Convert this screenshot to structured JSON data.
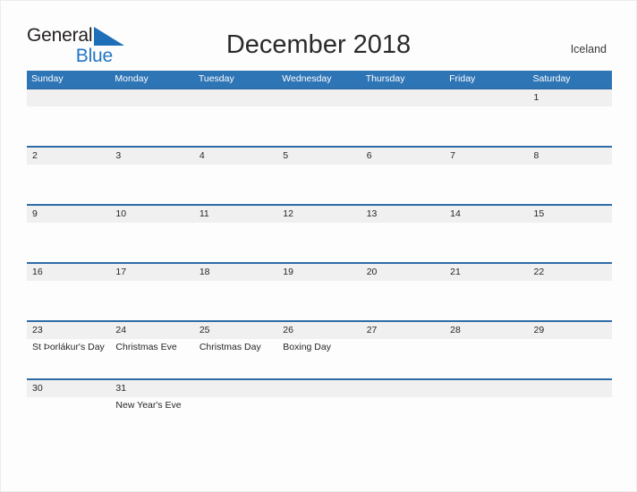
{
  "brand": {
    "word_one": "General",
    "word_two": "Blue",
    "flag_icon": "blue-triangle-flag-icon",
    "dark_color": "#231f20",
    "blue_color": "#2275c4"
  },
  "header": {
    "title": "December 2018",
    "region": "Iceland"
  },
  "colors": {
    "header_blue": "#2e75b6",
    "row_separator_blue": "#2e6ca8",
    "date_band_gray": "#f0f0f0",
    "text_dark": "#262626"
  },
  "calendar": {
    "month": "December",
    "year": "2018",
    "weekday_headers": [
      "Sunday",
      "Monday",
      "Tuesday",
      "Wednesday",
      "Thursday",
      "Friday",
      "Saturday"
    ],
    "weeks": [
      {
        "days": [
          {
            "date": "",
            "event": ""
          },
          {
            "date": "",
            "event": ""
          },
          {
            "date": "",
            "event": ""
          },
          {
            "date": "",
            "event": ""
          },
          {
            "date": "",
            "event": ""
          },
          {
            "date": "",
            "event": ""
          },
          {
            "date": "1",
            "event": ""
          }
        ]
      },
      {
        "days": [
          {
            "date": "2",
            "event": ""
          },
          {
            "date": "3",
            "event": ""
          },
          {
            "date": "4",
            "event": ""
          },
          {
            "date": "5",
            "event": ""
          },
          {
            "date": "6",
            "event": ""
          },
          {
            "date": "7",
            "event": ""
          },
          {
            "date": "8",
            "event": ""
          }
        ]
      },
      {
        "days": [
          {
            "date": "9",
            "event": ""
          },
          {
            "date": "10",
            "event": ""
          },
          {
            "date": "11",
            "event": ""
          },
          {
            "date": "12",
            "event": ""
          },
          {
            "date": "13",
            "event": ""
          },
          {
            "date": "14",
            "event": ""
          },
          {
            "date": "15",
            "event": ""
          }
        ]
      },
      {
        "days": [
          {
            "date": "16",
            "event": ""
          },
          {
            "date": "17",
            "event": ""
          },
          {
            "date": "18",
            "event": ""
          },
          {
            "date": "19",
            "event": ""
          },
          {
            "date": "20",
            "event": ""
          },
          {
            "date": "21",
            "event": ""
          },
          {
            "date": "22",
            "event": ""
          }
        ]
      },
      {
        "days": [
          {
            "date": "23",
            "event": "St Þorlákur's Day"
          },
          {
            "date": "24",
            "event": "Christmas Eve"
          },
          {
            "date": "25",
            "event": "Christmas Day"
          },
          {
            "date": "26",
            "event": "Boxing Day"
          },
          {
            "date": "27",
            "event": ""
          },
          {
            "date": "28",
            "event": ""
          },
          {
            "date": "29",
            "event": ""
          }
        ]
      },
      {
        "days": [
          {
            "date": "30",
            "event": ""
          },
          {
            "date": "31",
            "event": "New Year's Eve"
          },
          {
            "date": "",
            "event": ""
          },
          {
            "date": "",
            "event": ""
          },
          {
            "date": "",
            "event": ""
          },
          {
            "date": "",
            "event": ""
          },
          {
            "date": "",
            "event": ""
          }
        ]
      }
    ]
  }
}
